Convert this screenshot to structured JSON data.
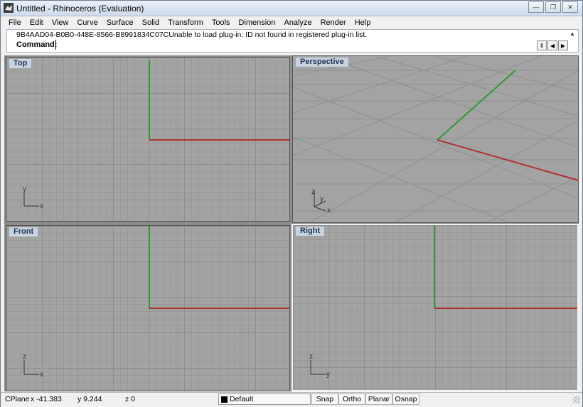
{
  "window": {
    "title": "Untitled - Rhinoceros (Evaluation)"
  },
  "menu": [
    "File",
    "Edit",
    "View",
    "Curve",
    "Surface",
    "Solid",
    "Transform",
    "Tools",
    "Dimension",
    "Analyze",
    "Render",
    "Help"
  ],
  "command": {
    "history": "9B4AAD04-B0B0-448E-8566-B8991834C07CUnable to load plug-in: ID not found in registered plug-in list.",
    "prompt": "Command:",
    "value": ""
  },
  "viewports": {
    "top": {
      "label": "Top",
      "axis_h": "x",
      "axis_v": "y"
    },
    "perspective": {
      "label": "Perspective",
      "axis_x": "x",
      "axis_y": "y",
      "axis_z": "z"
    },
    "front": {
      "label": "Front",
      "axis_h": "x",
      "axis_v": "z"
    },
    "right": {
      "label": "Right",
      "axis_h": "y",
      "axis_v": "z"
    }
  },
  "colors": {
    "x_axis": "#b03030",
    "y_axis": "#2e9a2e",
    "viewport_bg": "#a3a3a3"
  },
  "status": {
    "cplane": "CPlane",
    "x": "x -41.383",
    "y": "y 9.244",
    "z": "z 0",
    "layer": "Default",
    "snap": "Snap",
    "ortho": "Ortho",
    "planar": "Planar",
    "osnap": "Osnap"
  }
}
